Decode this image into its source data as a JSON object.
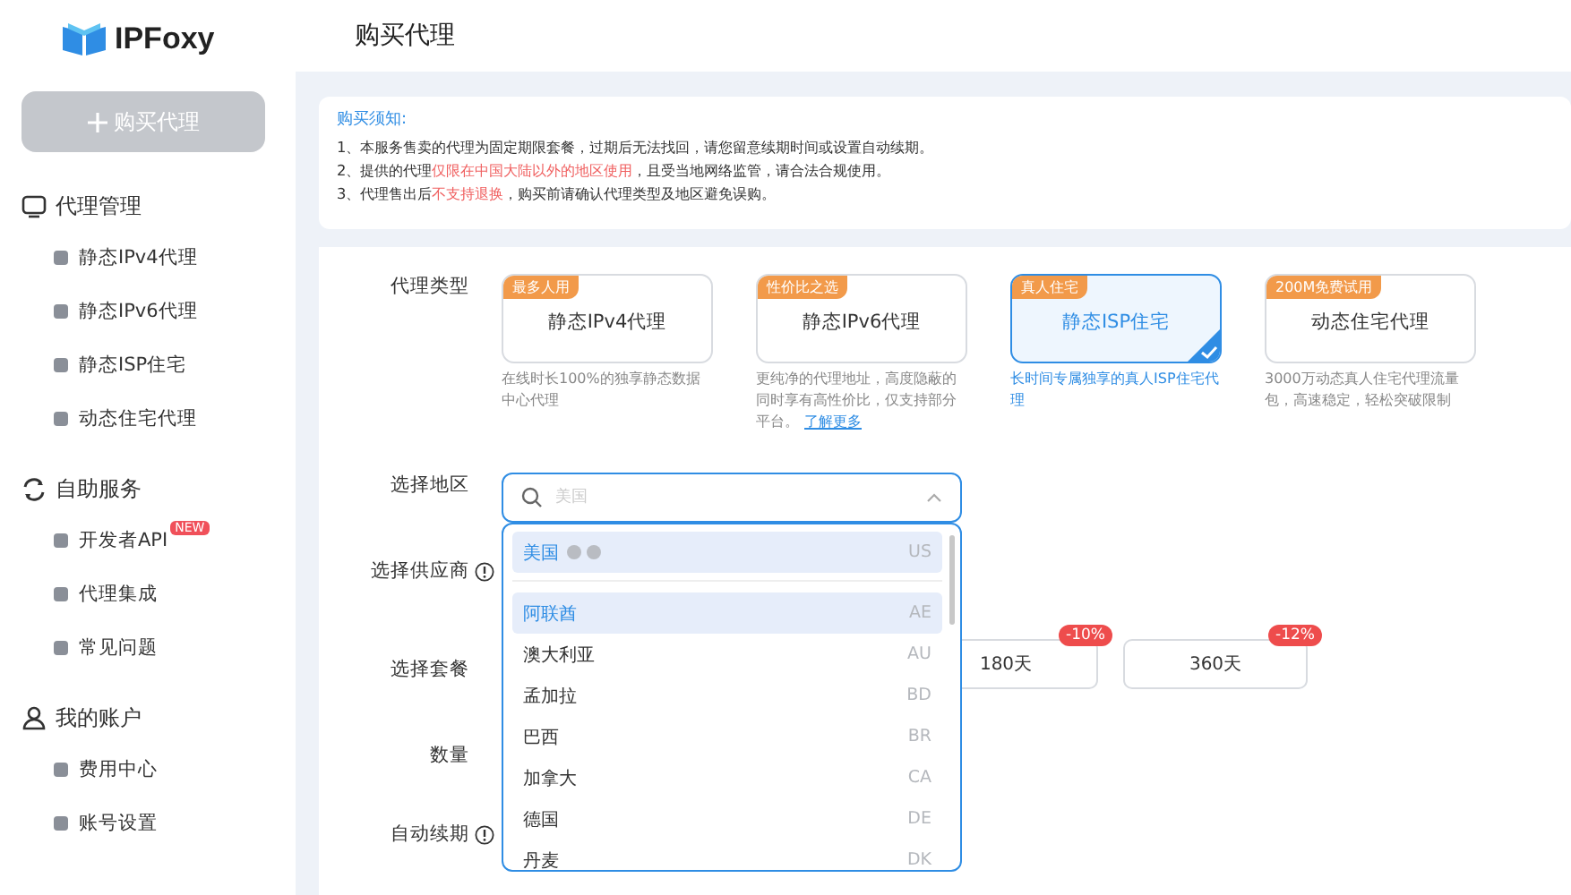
{
  "logo": "IPFoxy",
  "buy_button": "购买代理",
  "sidebar": [
    {
      "title": "代理管理",
      "items": [
        {
          "label": "静态IPv4代理"
        },
        {
          "label": "静态IPv6代理"
        },
        {
          "label": "静态ISP住宅"
        },
        {
          "label": "动态住宅代理"
        }
      ]
    },
    {
      "title": "自助服务",
      "items": [
        {
          "label": "开发者API",
          "badge": "NEW"
        },
        {
          "label": "代理集成"
        },
        {
          "label": "常见问题"
        }
      ]
    },
    {
      "title": "我的账户",
      "items": [
        {
          "label": "费用中心"
        },
        {
          "label": "账号设置"
        }
      ]
    }
  ],
  "page_title": "购买代理",
  "notice": {
    "title": "购买须知:",
    "lines": [
      [
        {
          "text": "1、本服务售卖的代理为固定期限套餐，过期后无法找回，请您留意续期时间或设置自动续期。",
          "kind": "plain"
        }
      ],
      [
        {
          "text": "2、提供的代理",
          "kind": "plain"
        },
        {
          "text": "仅限在中国大陆以外的地区使用",
          "kind": "warn"
        },
        {
          "text": "，且受当地网络监管，请合法合规使用。",
          "kind": "plain"
        }
      ],
      [
        {
          "text": "3、代理售出后",
          "kind": "plain"
        },
        {
          "text": "不支持退换",
          "kind": "warn"
        },
        {
          "text": "，购买前请确认代理类型及地区避免误购。",
          "kind": "plain"
        }
      ]
    ]
  },
  "form": {
    "type_label": "代理类型",
    "types": [
      {
        "tag": "最多人用",
        "name": "静态IPv4代理",
        "desc": "在线时长100%的独享静态数据中心代理",
        "selected": false
      },
      {
        "tag": "性价比之选",
        "name": "静态IPv6代理",
        "desc": "更纯净的代理地址，高度隐蔽的同时享有高性价比，仅支持部分平台。",
        "link": "了解更多",
        "selected": false
      },
      {
        "tag": "真人住宅",
        "name": "静态ISP住宅",
        "desc": "长时间专属独享的真人ISP住宅代理",
        "selected": true
      },
      {
        "tag": "200M免费试用",
        "name": "动态住宅代理",
        "desc": "3000万动态真人住宅代理流量包，高速稳定，轻松突破限制",
        "selected": false
      }
    ],
    "region_label": "选择地区",
    "region_placeholder": "美国",
    "pinned": {
      "name": "美国",
      "code": "US",
      "highlighted": true
    },
    "options": [
      {
        "name": "阿联酋",
        "code": "AE",
        "highlighted": true
      },
      {
        "name": "澳大利亚",
        "code": "AU",
        "highlighted": false
      },
      {
        "name": "孟加拉",
        "code": "BD",
        "highlighted": false
      },
      {
        "name": "巴西",
        "code": "BR",
        "highlighted": false
      },
      {
        "name": "加拿大",
        "code": "CA",
        "highlighted": false
      },
      {
        "name": "德国",
        "code": "DE",
        "highlighted": false
      },
      {
        "name": "丹麦",
        "code": "DK",
        "highlighted": false
      }
    ],
    "supplier_label": "选择供应商",
    "plan_label": "选择套餐",
    "plans": [
      {
        "label": "180天",
        "discount": "-10%"
      },
      {
        "label": "360天",
        "discount": "-12%"
      }
    ],
    "quantity_label": "数量",
    "renew_label": "自动续期"
  }
}
